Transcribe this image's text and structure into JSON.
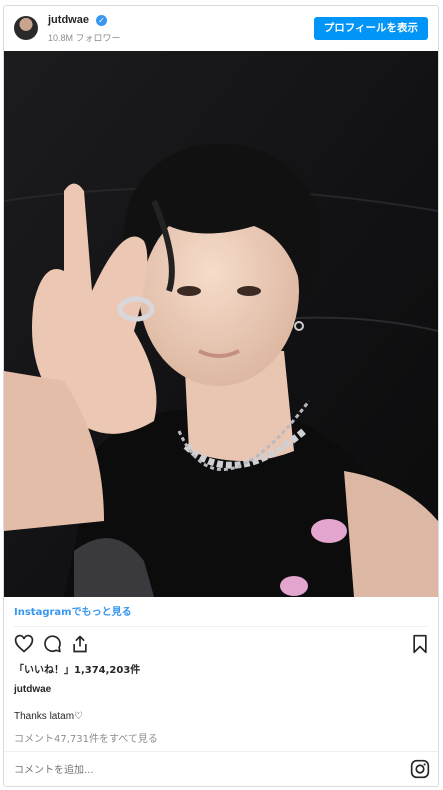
{
  "header": {
    "username": "jutdwae",
    "verified": true,
    "followers": "10.8M フォロワー",
    "profile_button": "プロフィールを表示"
  },
  "post": {
    "photo_alt": "selfie photo",
    "more_link": "Instagramでもっと見る",
    "likes": "「いいね！」1,374,203件",
    "author": "jutdwae",
    "caption": "Thanks latam♡",
    "comments_link": "コメント47,731件をすべて見る",
    "comment_placeholder": "コメントを追加..."
  },
  "icons": {
    "like": "heart-icon",
    "comment": "comment-icon",
    "share": "share-icon",
    "save": "bookmark-icon",
    "instagram": "instagram-icon"
  },
  "colors": {
    "accent": "#0095f6",
    "link": "#3897f0",
    "muted": "#8e8e8e"
  }
}
